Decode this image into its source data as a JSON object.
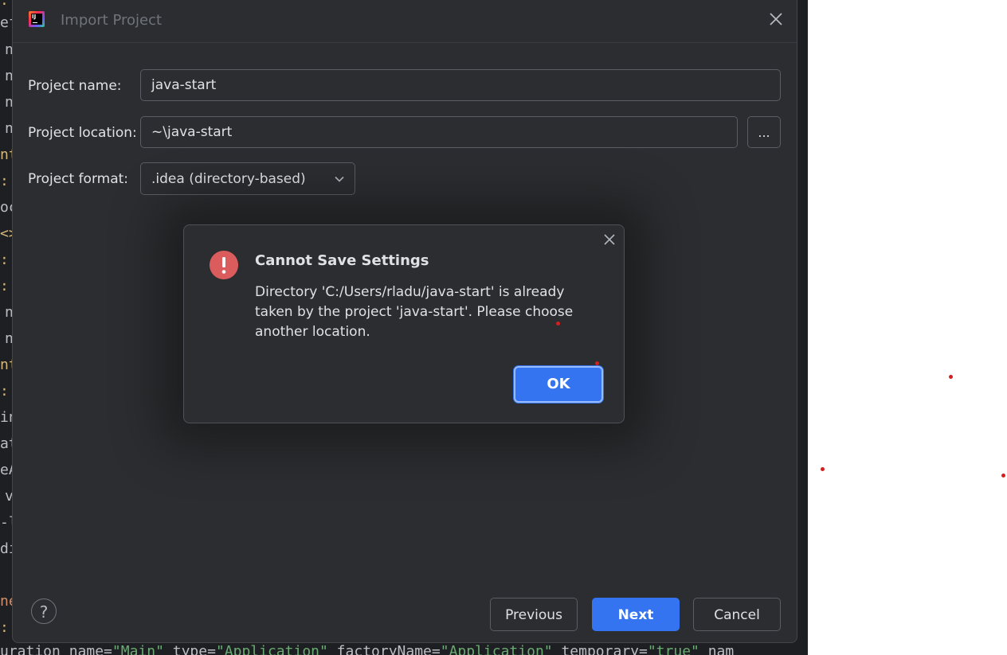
{
  "editor": {
    "lines": [
      "ef",
      "n",
      "n",
      "n",
      "n",
      "nt",
      ":",
      "oc",
      "<>",
      ":",
      ":",
      "n",
      "n",
      "nt",
      ":",
      "in",
      "at",
      "eA",
      "v",
      "-l",
      "di",
      "ne",
      ":"
    ],
    "bottom_line": {
      "p1": "uration name=",
      "s1": "\"Main\"",
      "p2": " type=",
      "s2": "\"Application\"",
      "p3": " factoryName=",
      "s3": "\"Application\"",
      "p4": " temporary=",
      "s4": "\"true\"",
      "p5": " nam"
    }
  },
  "dialog": {
    "title": "Import Project",
    "fields": {
      "name_label": "Project name:",
      "name_value": "java-start",
      "location_label": "Project location:",
      "location_value": "~\\java-start",
      "browse_label": "...",
      "format_label": "Project format:",
      "format_value": ".idea (directory-based)"
    },
    "footer": {
      "help_label": "?",
      "previous_label": "Previous",
      "next_label": "Next",
      "cancel_label": "Cancel"
    }
  },
  "alert": {
    "title": "Cannot Save Settings",
    "message": "Directory 'C:/Users/rladu/java-start' is already taken by the project 'java-start'. Please choose another location.",
    "ok_label": "OK"
  },
  "colors": {
    "accent": "#3574f0",
    "error": "#db5c5c",
    "panel": "#2b2d30"
  }
}
